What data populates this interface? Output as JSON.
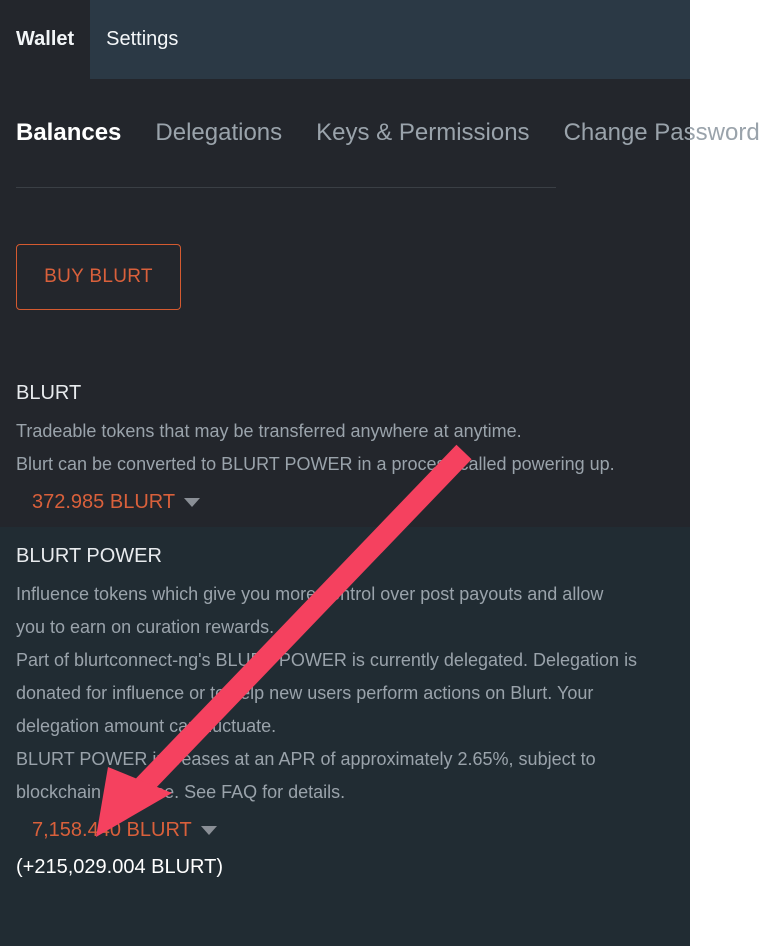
{
  "app": {
    "chrome_tabs": [
      {
        "label": "Wallet",
        "active": true
      },
      {
        "label": "Settings",
        "active": false
      }
    ]
  },
  "nav": {
    "items": [
      {
        "label": "Balances",
        "active": true
      },
      {
        "label": "Delegations",
        "active": false
      },
      {
        "label": "Keys & Permissions",
        "active": false
      },
      {
        "label": "Change Password",
        "active": false
      }
    ]
  },
  "toolbar": {
    "buy_label": "BUY BLURT"
  },
  "sections": {
    "blurt": {
      "title": "BLURT",
      "desc_line1": "Tradeable tokens that may be transferred anywhere at anytime.",
      "desc_line2": "Blurt can be converted to BLURT POWER in a process called powering up.",
      "amount": "372.985 BLURT"
    },
    "blurt_power": {
      "title": "BLURT POWER",
      "desc_line1": "Influence tokens which give you more control over post payouts and allow",
      "desc_line2": "you to earn on curation rewards.",
      "desc_line3": "Part of blurtconnect-ng's BLURT POWER is currently delegated. Delegation is",
      "desc_line4": "donated for influence or to help new users perform actions on Blurt. Your",
      "desc_line5": "delegation amount can fluctuate.",
      "desc_line6": "BLURT POWER increases at an APR of approximately 2.65%, subject to",
      "desc_line7": "blockchain variance. See FAQ for details.",
      "amount": "7,158.440 BLURT",
      "delegated_amount": "(+215,029.004 BLURT)"
    }
  },
  "colors": {
    "accent_orange": "#d9603b",
    "annotation_pink": "#f5415f",
    "panel_bg": "#23262c",
    "section_alt_bg": "#212c33",
    "header_bg": "#2b3945"
  },
  "annotation": {
    "arrow_label": "annotation-arrow"
  }
}
